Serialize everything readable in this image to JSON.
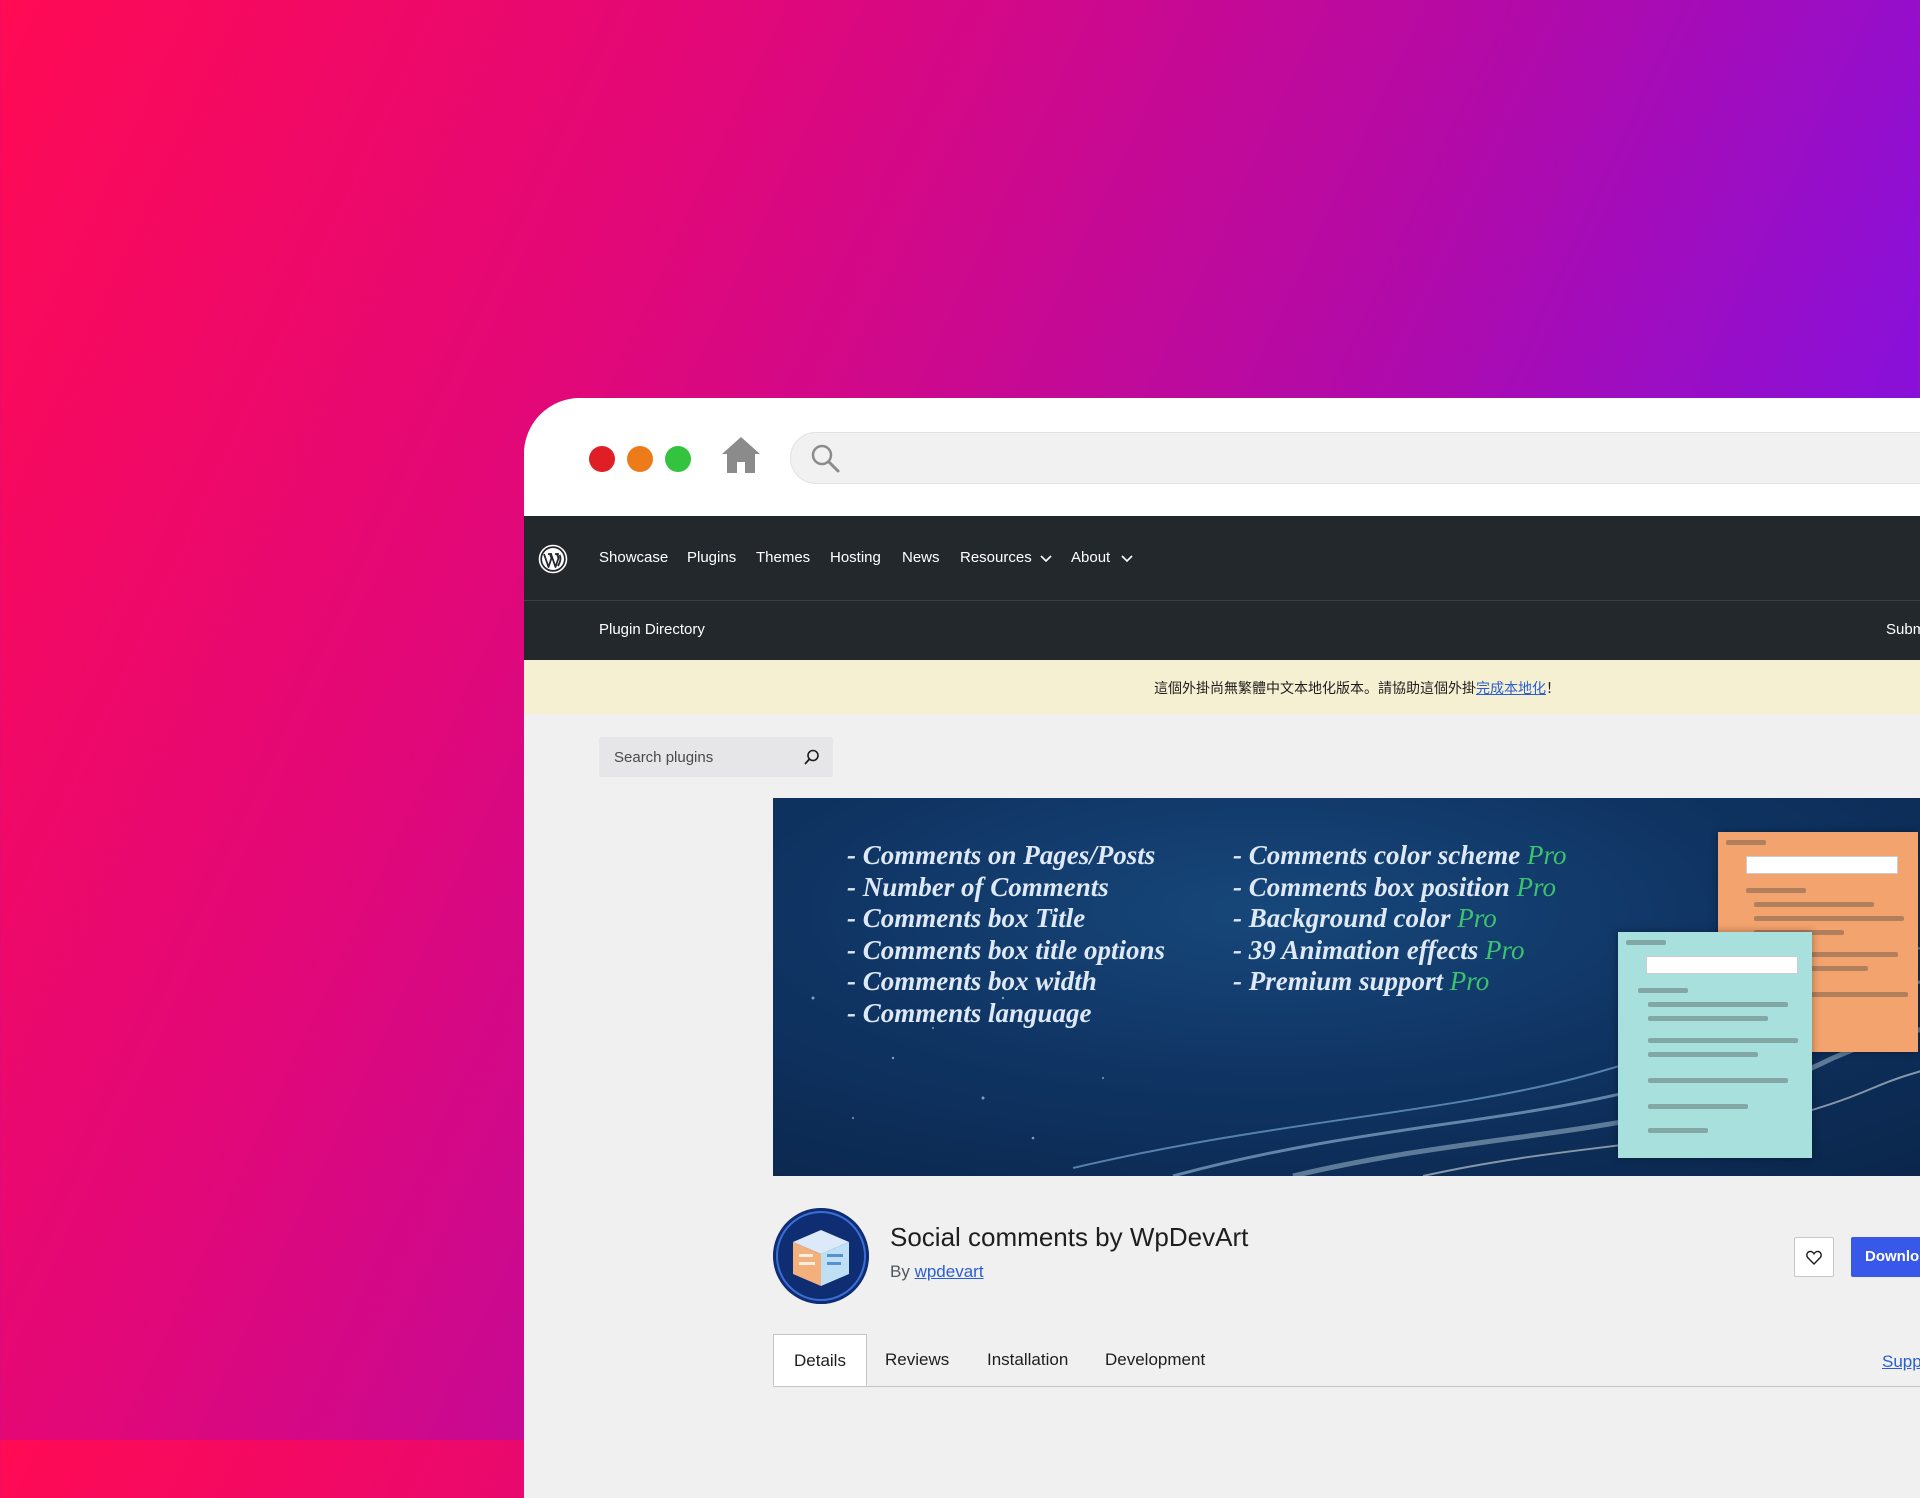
{
  "browser": {
    "icons": [
      "close-dot",
      "minimize-dot",
      "maximize-dot",
      "home-icon",
      "search-icon"
    ]
  },
  "nav": {
    "items": [
      {
        "label": "Showcase"
      },
      {
        "label": "Plugins"
      },
      {
        "label": "Themes"
      },
      {
        "label": "Hosting"
      },
      {
        "label": "News"
      },
      {
        "label": "Resources"
      },
      {
        "label": "About"
      }
    ],
    "plugin_directory": "Plugin Directory",
    "submit": "Subm"
  },
  "notice": {
    "text_before": "這個外掛尚無繁體中文本地化版本。請協助這個外掛",
    "link": "完成本地化",
    "text_after": "！"
  },
  "search": {
    "placeholder": "Search plugins"
  },
  "banner": {
    "left": [
      "- Comments on Pages/Posts",
      "- Number of Comments",
      "- Comments box Title",
      "- Comments box title options",
      "- Comments box width",
      "- Comments language"
    ],
    "right": [
      {
        "text": "- Comments color scheme ",
        "pro": "Pro"
      },
      {
        "text": "- Comments box position ",
        "pro": "Pro"
      },
      {
        "text": "- Background color ",
        "pro": "Pro"
      },
      {
        "text": "- 39 Animation effects ",
        "pro": "Pro"
      },
      {
        "text": "- Premium support ",
        "pro": "Pro"
      }
    ]
  },
  "plugin": {
    "title": "Social comments by WpDevArt",
    "by": "By",
    "author": "wpdevart",
    "download": "Downlo"
  },
  "tabs": [
    "Details",
    "Reviews",
    "Installation",
    "Development"
  ],
  "support": "Supp",
  "colors": {
    "accent": "#3858e9",
    "nav_bg": "#23282d",
    "notice_bg": "#f5f0d2",
    "pro": "#3cc36e"
  }
}
